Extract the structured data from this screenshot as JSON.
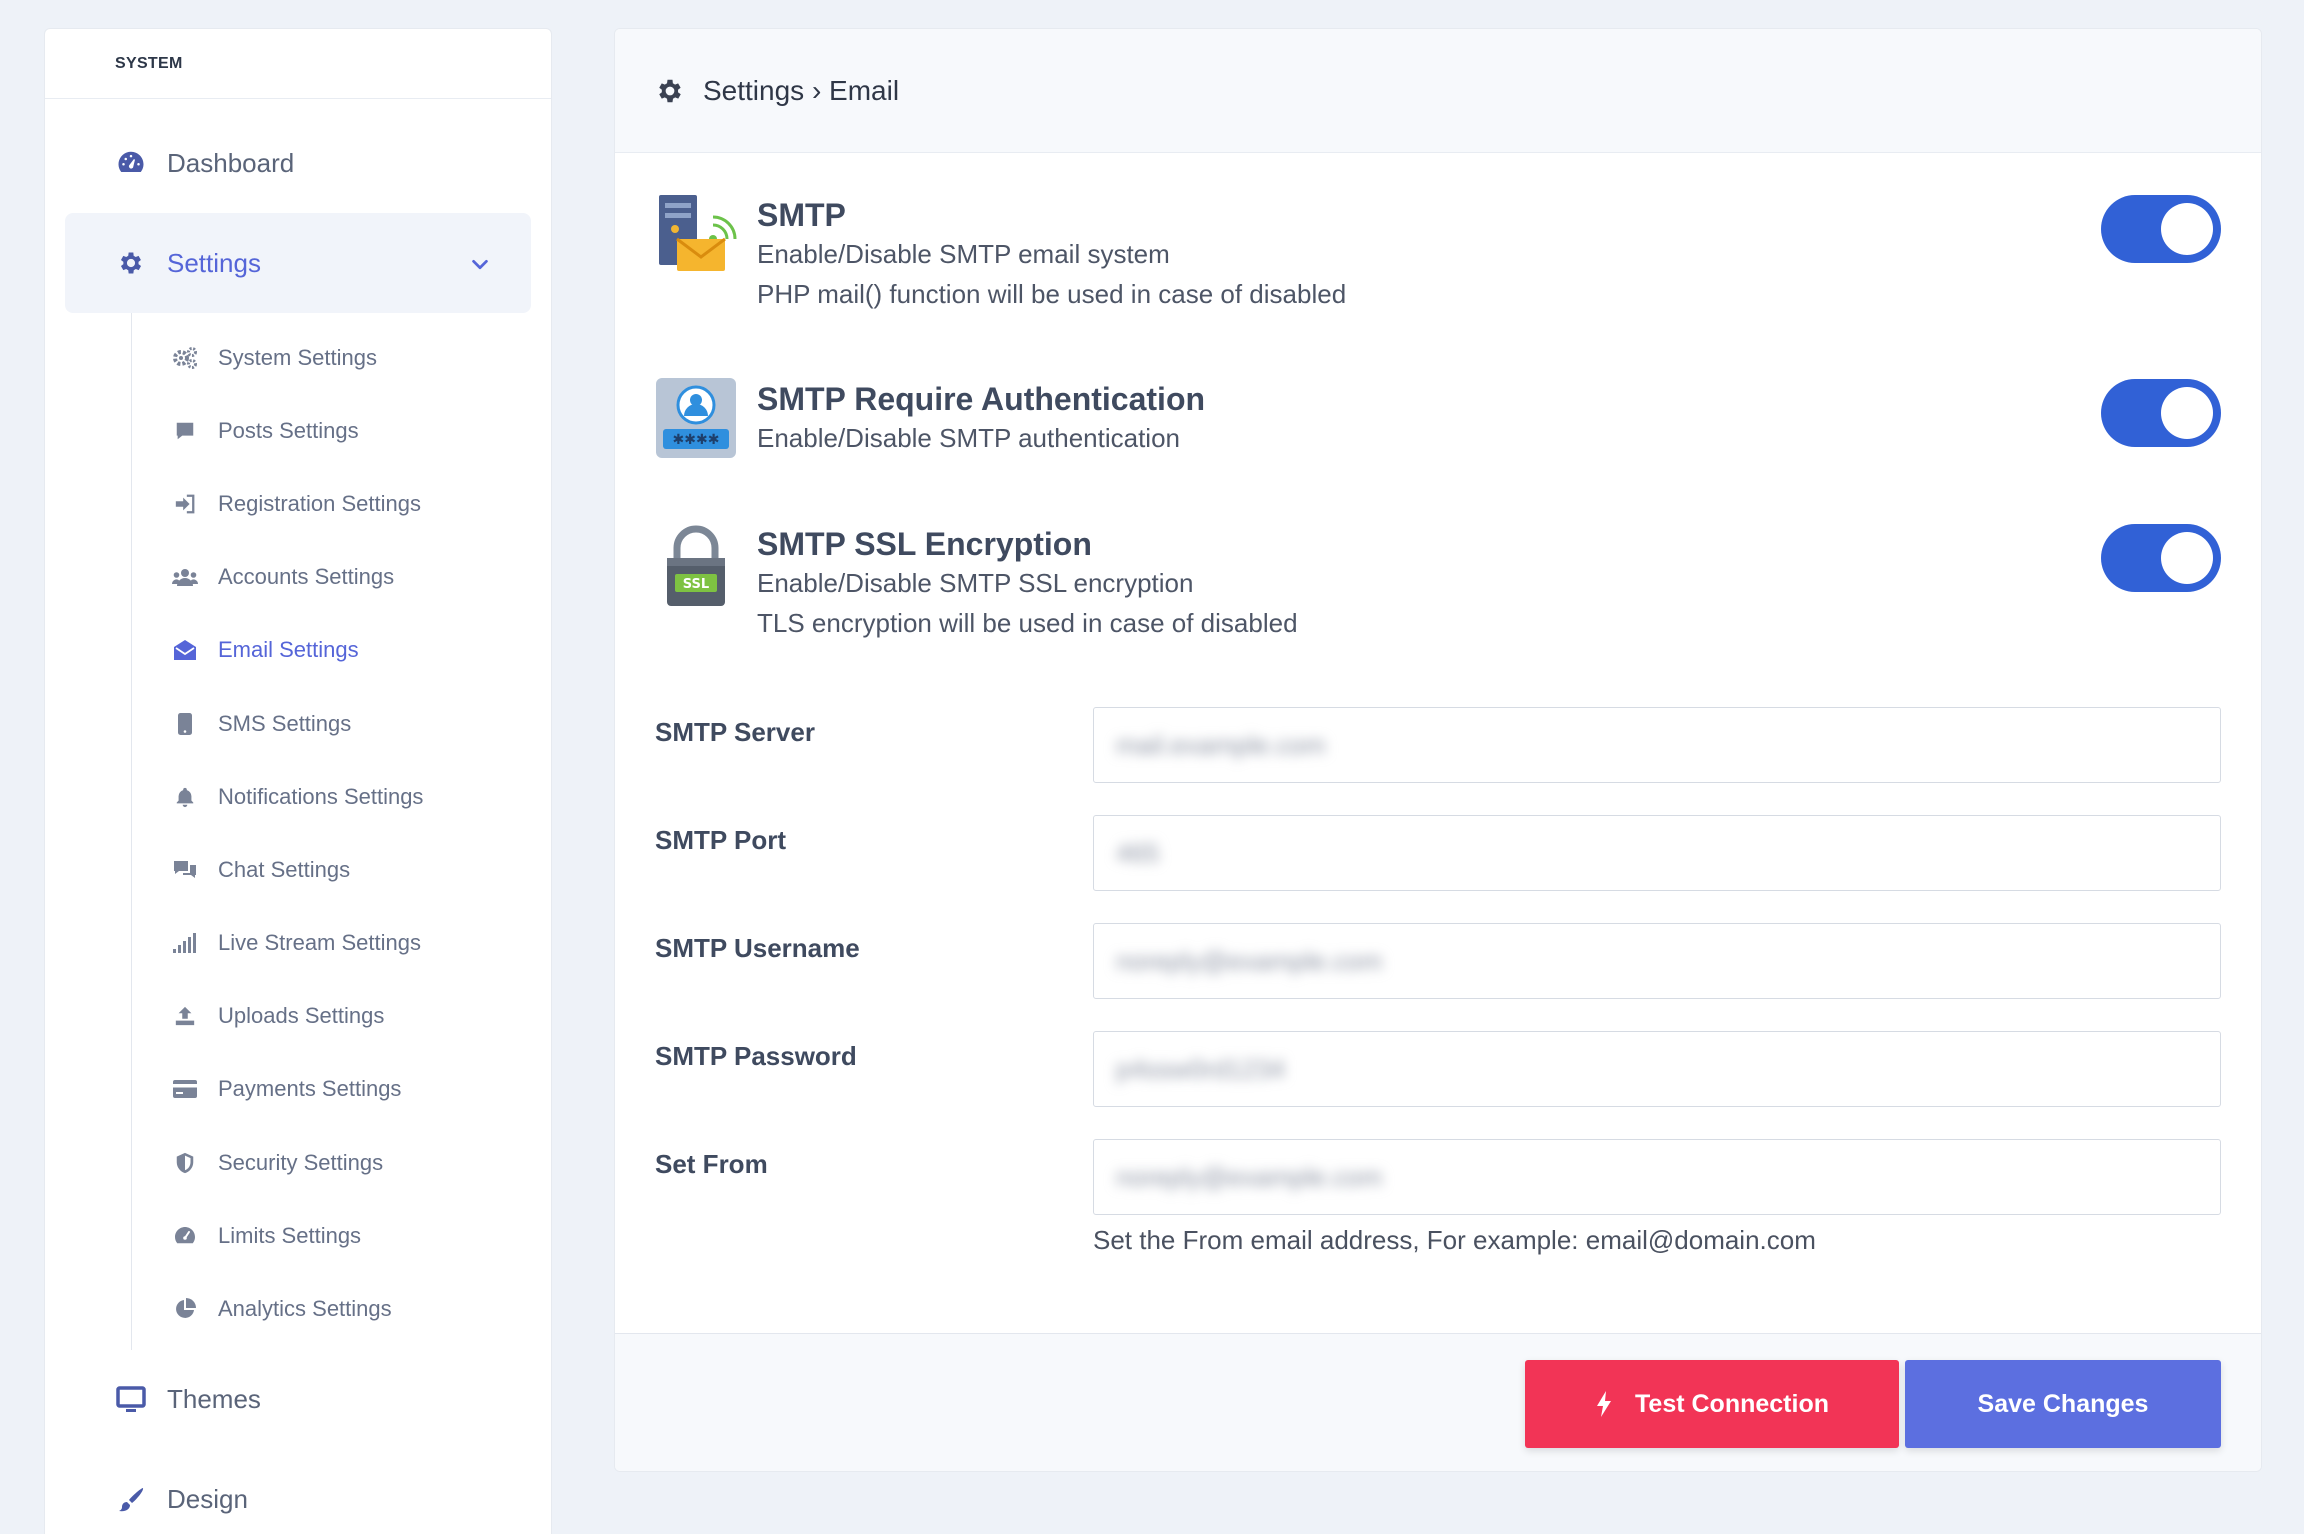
{
  "sidebar": {
    "header": "SYSTEM",
    "top_items": [
      {
        "label": "Dashboard",
        "icon": "dashboard-gauge-icon"
      },
      {
        "label": "Settings",
        "icon": "gear-icon",
        "active": true,
        "expanded": true
      }
    ],
    "sub_items": [
      {
        "label": "System Settings",
        "icon": "cogs-icon"
      },
      {
        "label": "Posts Settings",
        "icon": "comment-icon"
      },
      {
        "label": "Registration Settings",
        "icon": "sign-in-icon"
      },
      {
        "label": "Accounts Settings",
        "icon": "users-icon"
      },
      {
        "label": "Email Settings",
        "icon": "envelope-open-icon",
        "active": true
      },
      {
        "label": "SMS Settings",
        "icon": "mobile-icon"
      },
      {
        "label": "Notifications Settings",
        "icon": "bell-icon"
      },
      {
        "label": "Chat Settings",
        "icon": "chat-bubbles-icon"
      },
      {
        "label": "Live Stream Settings",
        "icon": "signal-bars-icon"
      },
      {
        "label": "Uploads Settings",
        "icon": "upload-icon"
      },
      {
        "label": "Payments Settings",
        "icon": "credit-card-icon"
      },
      {
        "label": "Security Settings",
        "icon": "shield-icon"
      },
      {
        "label": "Limits Settings",
        "icon": "gauge-icon"
      },
      {
        "label": "Analytics Settings",
        "icon": "pie-chart-icon"
      }
    ],
    "bottom_items": [
      {
        "label": "Themes",
        "icon": "monitor-icon"
      },
      {
        "label": "Design",
        "icon": "paint-brush-icon"
      }
    ]
  },
  "main": {
    "breadcrumb": "Settings › Email",
    "toggles": [
      {
        "title": "SMTP",
        "lines": [
          "Enable/Disable SMTP email system",
          "PHP mail() function will be used in case of disabled"
        ],
        "enabled": true,
        "icon": "smtp-server-mail-icon"
      },
      {
        "title": "SMTP Require Authentication",
        "lines": [
          "Enable/Disable SMTP authentication"
        ],
        "enabled": true,
        "icon": "user-password-icon"
      },
      {
        "title": "SMTP SSL Encryption",
        "lines": [
          "Enable/Disable SMTP SSL encryption",
          "TLS encryption will be used in case of disabled"
        ],
        "enabled": true,
        "icon": "ssl-padlock-icon"
      }
    ],
    "fields": [
      {
        "label": "SMTP Server",
        "value": "mail.example.com"
      },
      {
        "label": "SMTP Port",
        "value": "465"
      },
      {
        "label": "SMTP Username",
        "value": "noreply@example.com"
      },
      {
        "label": "SMTP Password",
        "value": "p4ssw0rd1234"
      },
      {
        "label": "Set From",
        "value": "noreply@example.com"
      }
    ],
    "set_from_hint": "Set the From email address, For example: email@domain.com",
    "buttons": {
      "test": "Test Connection",
      "save": "Save Changes"
    }
  },
  "colors": {
    "accent": "#5565d8",
    "toggle_on": "#3161d6",
    "test_button": "#f23456",
    "save_button": "#5c6fe0",
    "page_bg": "#eef2f8"
  }
}
